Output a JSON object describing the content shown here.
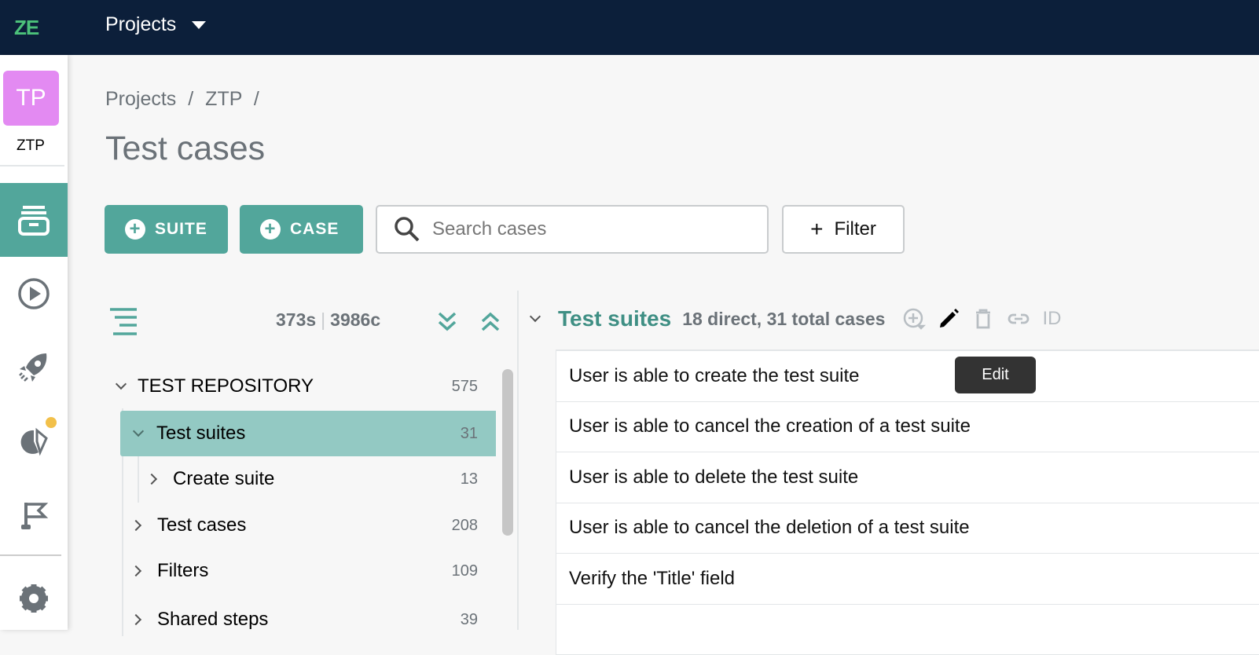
{
  "topbar": {
    "logo": "ZE",
    "projects_label": "Projects"
  },
  "project": {
    "initials": "TP",
    "name": "ZTP",
    "avatar_color": "#e38af2"
  },
  "nav": {
    "items": [
      {
        "icon": "test-cases-icon",
        "active": true
      },
      {
        "icon": "play-icon"
      },
      {
        "icon": "rocket-icon"
      },
      {
        "icon": "reports-pie-icon",
        "badge": true
      },
      {
        "icon": "flag-icon"
      },
      {
        "icon": "gear-icon"
      }
    ]
  },
  "breadcrumb": {
    "items": [
      "Projects",
      "ZTP"
    ],
    "sep": "/"
  },
  "page": {
    "title": "Test cases"
  },
  "toolbar": {
    "suite_label": "SUITE",
    "case_label": "CASE",
    "search_placeholder": "Search cases",
    "filter_label": "Filter"
  },
  "tree": {
    "suites_count": "373s",
    "cases_count": "3986c",
    "root": {
      "label": "TEST REPOSITORY",
      "count": "575"
    },
    "items": [
      {
        "label": "Test suites",
        "count": "31",
        "selected": true
      },
      {
        "label": "Create suite",
        "count": "13"
      },
      {
        "label": "Test cases",
        "count": "208"
      },
      {
        "label": "Filters",
        "count": "109"
      },
      {
        "label": "Shared steps",
        "count": "39"
      }
    ]
  },
  "suite": {
    "title": "Test suites",
    "summary": "18 direct, 31 total cases",
    "id_label": "ID",
    "tooltip": "Edit",
    "cases": [
      "User is able to create the test suite",
      "User is able to cancel the creation of a test suite",
      "User is able to delete the test suite",
      "User is able to cancel the deletion of a test suite",
      "Verify the 'Title' field",
      ""
    ]
  },
  "colors": {
    "accent": "#52a69b",
    "selected": "#93c9c3",
    "topbar": "#0c1f3a"
  }
}
